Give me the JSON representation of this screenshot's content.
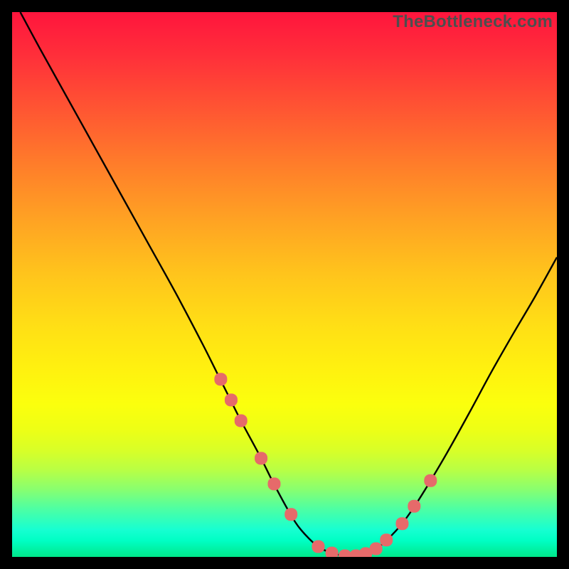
{
  "watermark": "TheBottleneck.com",
  "colors": {
    "background": "#000000",
    "curve_stroke": "#000000",
    "marker_fill": "#e66a6a",
    "gradient_top": "#ff153d",
    "gradient_bottom": "#00e88a"
  },
  "chart_data": {
    "type": "line",
    "title": "",
    "xlabel": "",
    "ylabel": "",
    "xlim": [
      0,
      100
    ],
    "ylim": [
      0,
      100
    ],
    "grid": false,
    "legend": false,
    "series": [
      {
        "name": "bottleneck-curve",
        "x": [
          1.5,
          5,
          10,
          15,
          20,
          25,
          30,
          35,
          38,
          40,
          42,
          45.5,
          48,
          51,
          53,
          56,
          58.5,
          61,
          63,
          65,
          67,
          69,
          71.5,
          74,
          77,
          80,
          84,
          88,
          92,
          96,
          100
        ],
        "y": [
          100,
          93.5,
          84.5,
          75.5,
          66.5,
          57.5,
          48.5,
          39,
          33,
          29,
          25,
          18.5,
          13.5,
          8,
          5,
          2,
          0.8,
          0.2,
          0.2,
          0.6,
          1.6,
          3.3,
          6,
          9.5,
          14.3,
          19.4,
          26.6,
          34,
          41,
          47.8,
          55
        ]
      }
    ],
    "markers": {
      "name": "highlight-dots",
      "x": [
        38.3,
        40.2,
        42.0,
        45.7,
        48.1,
        51.2,
        56.2,
        58.7,
        61.1,
        63.1,
        64.9,
        66.8,
        68.7,
        71.6,
        73.8,
        76.8
      ],
      "y": [
        32.6,
        28.8,
        25.0,
        18.1,
        13.4,
        7.8,
        1.9,
        0.7,
        0.2,
        0.2,
        0.6,
        1.5,
        3.1,
        6.1,
        9.3,
        14.0
      ]
    }
  }
}
